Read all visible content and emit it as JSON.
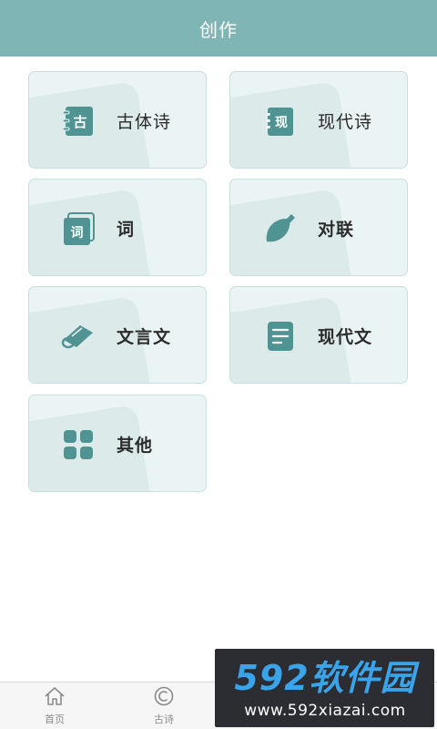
{
  "header": {
    "title": "创作"
  },
  "cards": [
    {
      "label": "古体诗",
      "icon": "notebook-gu-icon",
      "glyph": "古"
    },
    {
      "label": "现代诗",
      "icon": "notebook-xian-icon",
      "glyph": "现"
    },
    {
      "label": "词",
      "icon": "book-ci-icon",
      "glyph": "词"
    },
    {
      "label": "对联",
      "icon": "leaf-brush-icon"
    },
    {
      "label": "文言文",
      "icon": "scroll-icon"
    },
    {
      "label": "现代文",
      "icon": "document-icon"
    },
    {
      "label": "其他",
      "icon": "grid-four-icon"
    }
  ],
  "tabbar": {
    "tabs": [
      {
        "label": "首页",
        "icon": "home-icon"
      },
      {
        "label": "古诗",
        "icon": "copyright-icon"
      },
      {
        "label": "",
        "icon": "search-circle-icon"
      },
      {
        "label": "",
        "icon": "search-icon"
      }
    ]
  },
  "watermark": {
    "title": "592软件园",
    "url": "www.592xiazai.com"
  },
  "colors": {
    "header": "#7fb5b5",
    "icon": "#4f9393",
    "card_bg": "#eaf4f4",
    "card_border": "#c9dede"
  }
}
